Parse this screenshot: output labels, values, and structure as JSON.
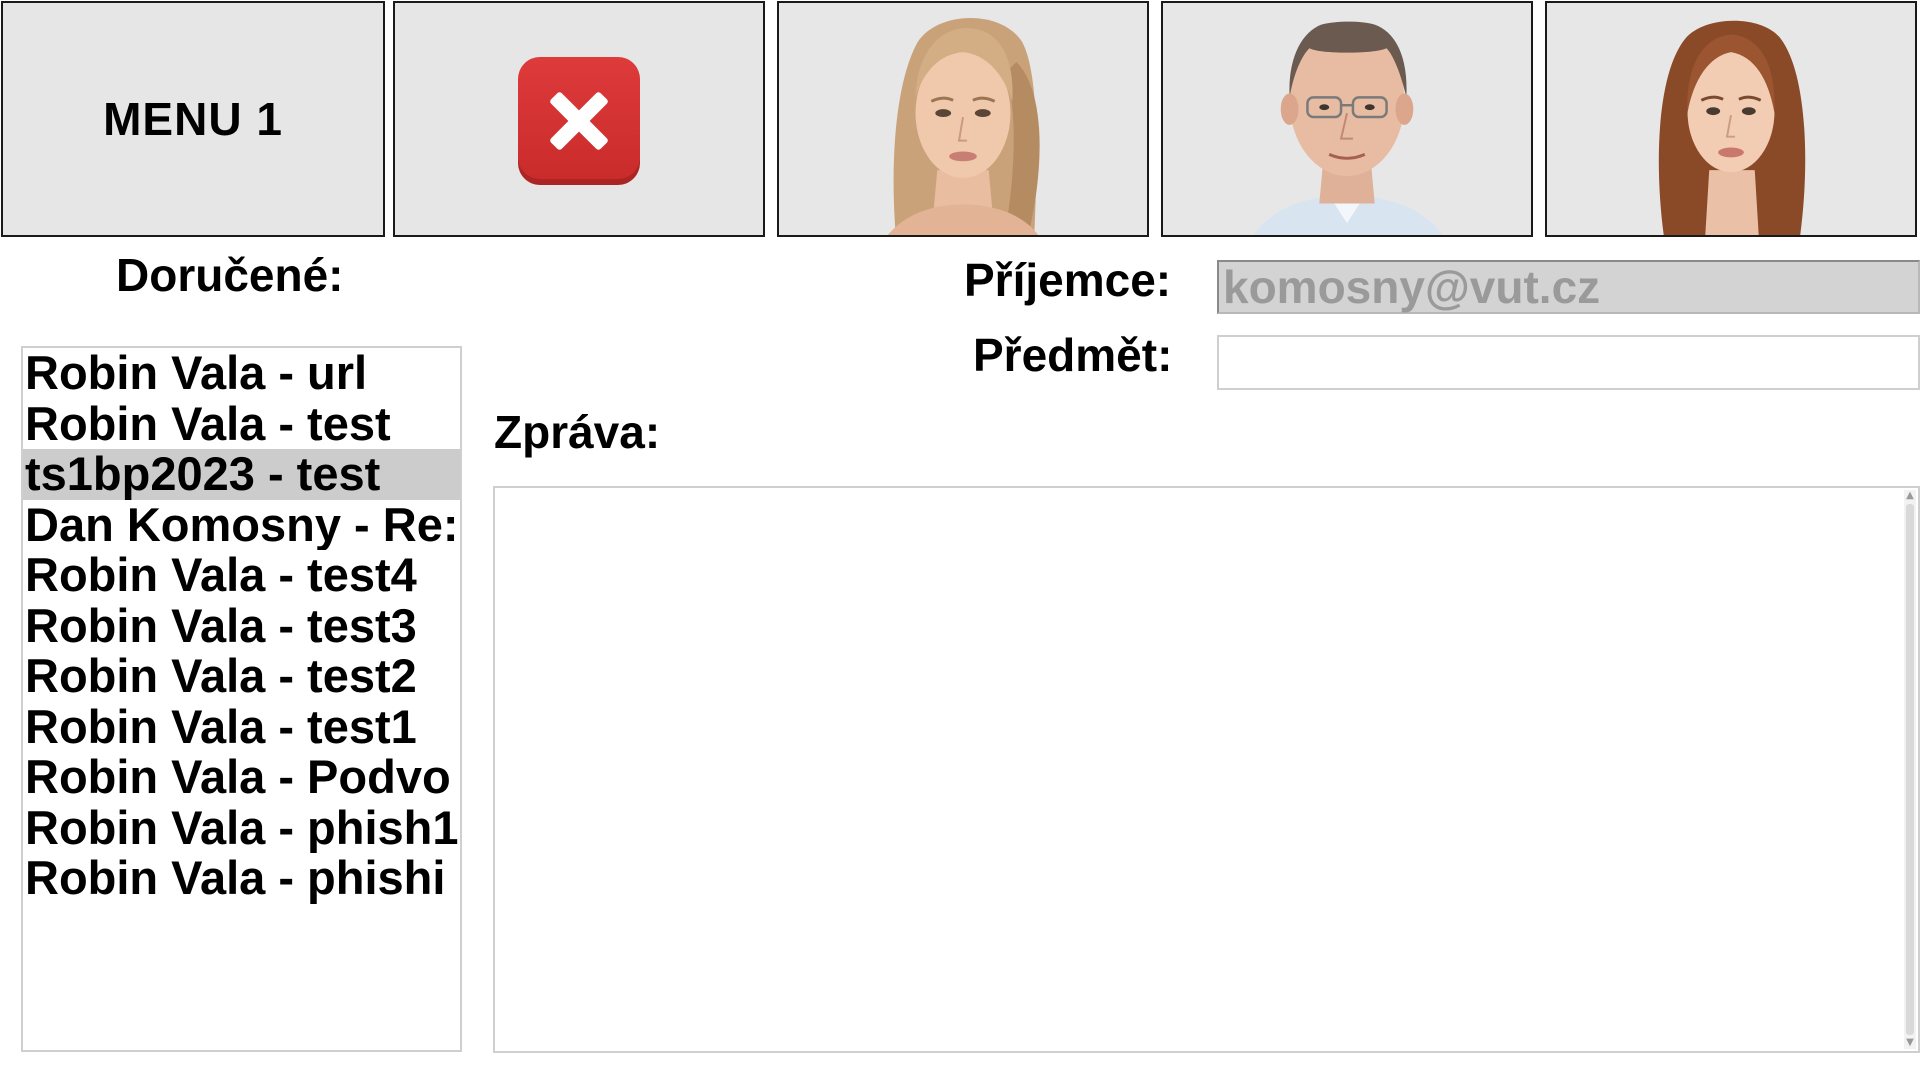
{
  "toolbar": {
    "menu_label": "MENU 1",
    "close_icon": "close-icon",
    "contacts": [
      {
        "icon": "avatar-young-woman-blonde"
      },
      {
        "icon": "avatar-man-glasses"
      },
      {
        "icon": "avatar-young-woman-brown-hair"
      }
    ]
  },
  "inbox": {
    "label": "Doručené:",
    "items": [
      "Robin Vala - url",
      "Robin Vala - test",
      "ts1bp2023 - test",
      "Dan Komosny - Re:",
      "Robin Vala - test4",
      "Robin Vala - test3",
      "Robin Vala - test2",
      "Robin Vala - test1",
      "Robin Vala - Podvo",
      "Robin Vala - phish1",
      "Robin Vala - phishi"
    ],
    "selected_index": 2
  },
  "compose": {
    "recipient_label": "Příjemce:",
    "recipient_value": "komosny@vut.cz",
    "subject_label": "Předmět:",
    "subject_value": "",
    "message_label": "Zpráva:",
    "message_value": ""
  },
  "colors": {
    "tile_background": "#e6e6e6",
    "close_red": "#d93434",
    "selected_row": "#cccccc",
    "readonly_field": "#d3d3d3"
  }
}
